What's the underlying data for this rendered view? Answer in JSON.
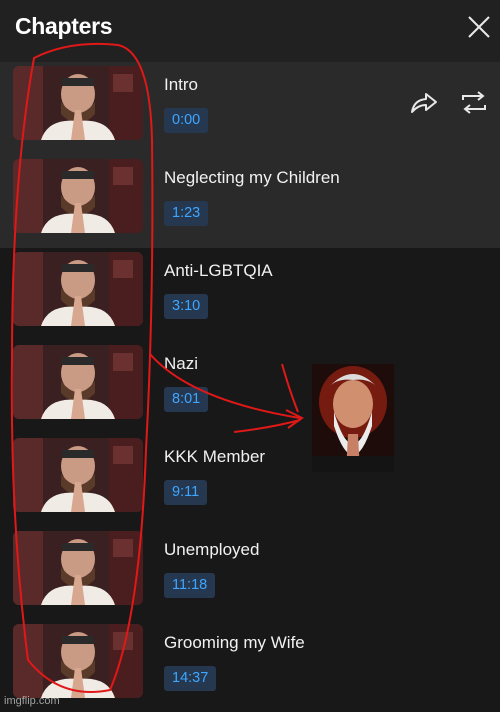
{
  "header": {
    "title": "Chapters",
    "close_icon": "close-icon"
  },
  "actions": {
    "share_icon": "share-icon",
    "loop_icon": "loop-icon"
  },
  "chapters": [
    {
      "title": "Intro",
      "time": "0:00",
      "active": true
    },
    {
      "title": "Neglecting my Children",
      "time": "1:23",
      "active": true
    },
    {
      "title": "Anti-LGBTQIA",
      "time": "3:10",
      "active": false
    },
    {
      "title": "Nazi",
      "time": "8:01",
      "active": false
    },
    {
      "title": "KKK Member",
      "time": "9:11",
      "active": false
    },
    {
      "title": "Unemployed",
      "time": "11:18",
      "active": false
    },
    {
      "title": "Grooming my Wife",
      "time": "14:37",
      "active": false
    }
  ],
  "watermark": "imgflip.com",
  "colors": {
    "background": "#181818",
    "active_row": "#2a2a2a",
    "timestamp_bg": "#263850",
    "timestamp_text": "#3ea6ff",
    "annotation_red": "#e01818"
  }
}
